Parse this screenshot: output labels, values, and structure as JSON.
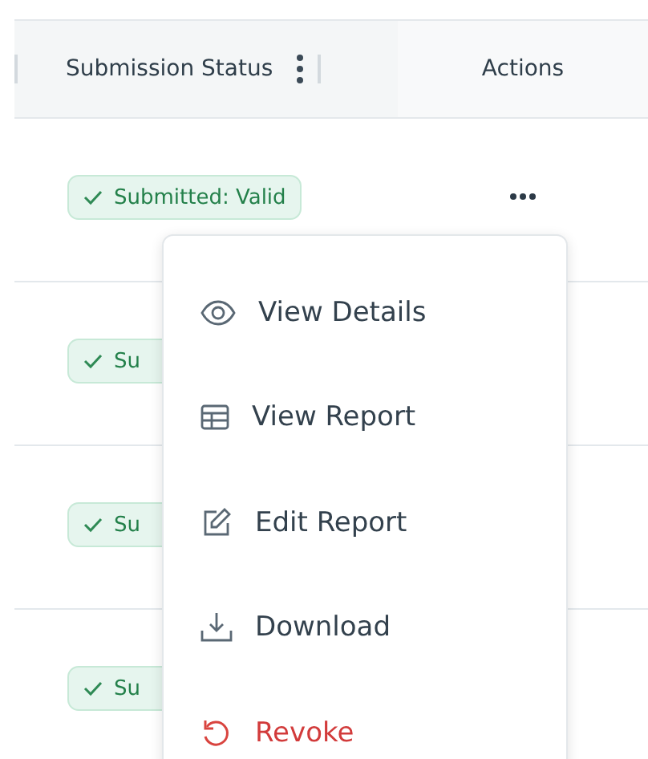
{
  "table": {
    "columns": [
      {
        "label": "Submission Status"
      },
      {
        "label": "Actions"
      }
    ],
    "rows": [
      {
        "status": "Submitted: Valid",
        "has_actions": true
      },
      {
        "status": "Su",
        "has_actions": false
      },
      {
        "status": "Su",
        "has_actions": false
      },
      {
        "status": "Su",
        "has_actions": false
      }
    ]
  },
  "menu": {
    "items": [
      {
        "label": "View Details",
        "kind": "view"
      },
      {
        "label": "View Report",
        "kind": "table"
      },
      {
        "label": "Edit Report",
        "kind": "edit"
      },
      {
        "label": "Download",
        "kind": "download"
      },
      {
        "label": "Revoke",
        "kind": "revoke"
      }
    ]
  }
}
